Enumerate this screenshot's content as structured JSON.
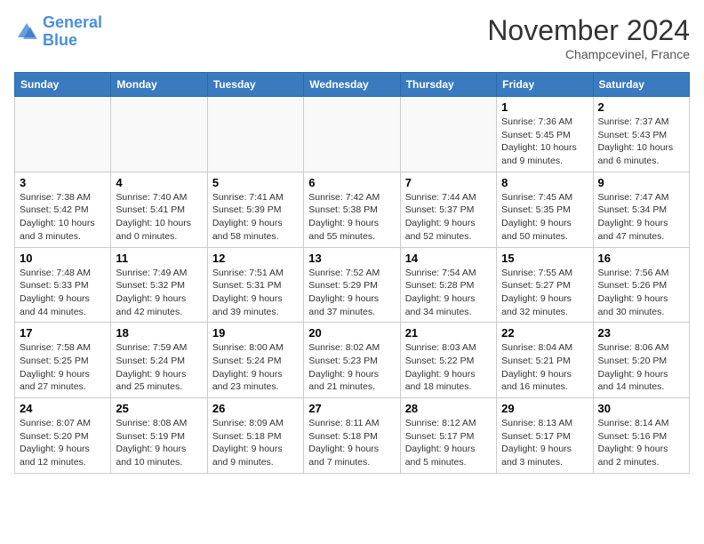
{
  "header": {
    "logo_line1": "General",
    "logo_line2": "Blue",
    "month_title": "November 2024",
    "location": "Champcevinel, France"
  },
  "weekdays": [
    "Sunday",
    "Monday",
    "Tuesday",
    "Wednesday",
    "Thursday",
    "Friday",
    "Saturday"
  ],
  "weeks": [
    [
      {
        "day": "",
        "info": ""
      },
      {
        "day": "",
        "info": ""
      },
      {
        "day": "",
        "info": ""
      },
      {
        "day": "",
        "info": ""
      },
      {
        "day": "",
        "info": ""
      },
      {
        "day": "1",
        "info": "Sunrise: 7:36 AM\nSunset: 5:45 PM\nDaylight: 10 hours and 9 minutes."
      },
      {
        "day": "2",
        "info": "Sunrise: 7:37 AM\nSunset: 5:43 PM\nDaylight: 10 hours and 6 minutes."
      }
    ],
    [
      {
        "day": "3",
        "info": "Sunrise: 7:38 AM\nSunset: 5:42 PM\nDaylight: 10 hours and 3 minutes."
      },
      {
        "day": "4",
        "info": "Sunrise: 7:40 AM\nSunset: 5:41 PM\nDaylight: 10 hours and 0 minutes."
      },
      {
        "day": "5",
        "info": "Sunrise: 7:41 AM\nSunset: 5:39 PM\nDaylight: 9 hours and 58 minutes."
      },
      {
        "day": "6",
        "info": "Sunrise: 7:42 AM\nSunset: 5:38 PM\nDaylight: 9 hours and 55 minutes."
      },
      {
        "day": "7",
        "info": "Sunrise: 7:44 AM\nSunset: 5:37 PM\nDaylight: 9 hours and 52 minutes."
      },
      {
        "day": "8",
        "info": "Sunrise: 7:45 AM\nSunset: 5:35 PM\nDaylight: 9 hours and 50 minutes."
      },
      {
        "day": "9",
        "info": "Sunrise: 7:47 AM\nSunset: 5:34 PM\nDaylight: 9 hours and 47 minutes."
      }
    ],
    [
      {
        "day": "10",
        "info": "Sunrise: 7:48 AM\nSunset: 5:33 PM\nDaylight: 9 hours and 44 minutes."
      },
      {
        "day": "11",
        "info": "Sunrise: 7:49 AM\nSunset: 5:32 PM\nDaylight: 9 hours and 42 minutes."
      },
      {
        "day": "12",
        "info": "Sunrise: 7:51 AM\nSunset: 5:31 PM\nDaylight: 9 hours and 39 minutes."
      },
      {
        "day": "13",
        "info": "Sunrise: 7:52 AM\nSunset: 5:29 PM\nDaylight: 9 hours and 37 minutes."
      },
      {
        "day": "14",
        "info": "Sunrise: 7:54 AM\nSunset: 5:28 PM\nDaylight: 9 hours and 34 minutes."
      },
      {
        "day": "15",
        "info": "Sunrise: 7:55 AM\nSunset: 5:27 PM\nDaylight: 9 hours and 32 minutes."
      },
      {
        "day": "16",
        "info": "Sunrise: 7:56 AM\nSunset: 5:26 PM\nDaylight: 9 hours and 30 minutes."
      }
    ],
    [
      {
        "day": "17",
        "info": "Sunrise: 7:58 AM\nSunset: 5:25 PM\nDaylight: 9 hours and 27 minutes."
      },
      {
        "day": "18",
        "info": "Sunrise: 7:59 AM\nSunset: 5:24 PM\nDaylight: 9 hours and 25 minutes."
      },
      {
        "day": "19",
        "info": "Sunrise: 8:00 AM\nSunset: 5:24 PM\nDaylight: 9 hours and 23 minutes."
      },
      {
        "day": "20",
        "info": "Sunrise: 8:02 AM\nSunset: 5:23 PM\nDaylight: 9 hours and 21 minutes."
      },
      {
        "day": "21",
        "info": "Sunrise: 8:03 AM\nSunset: 5:22 PM\nDaylight: 9 hours and 18 minutes."
      },
      {
        "day": "22",
        "info": "Sunrise: 8:04 AM\nSunset: 5:21 PM\nDaylight: 9 hours and 16 minutes."
      },
      {
        "day": "23",
        "info": "Sunrise: 8:06 AM\nSunset: 5:20 PM\nDaylight: 9 hours and 14 minutes."
      }
    ],
    [
      {
        "day": "24",
        "info": "Sunrise: 8:07 AM\nSunset: 5:20 PM\nDaylight: 9 hours and 12 minutes."
      },
      {
        "day": "25",
        "info": "Sunrise: 8:08 AM\nSunset: 5:19 PM\nDaylight: 9 hours and 10 minutes."
      },
      {
        "day": "26",
        "info": "Sunrise: 8:09 AM\nSunset: 5:18 PM\nDaylight: 9 hours and 9 minutes."
      },
      {
        "day": "27",
        "info": "Sunrise: 8:11 AM\nSunset: 5:18 PM\nDaylight: 9 hours and 7 minutes."
      },
      {
        "day": "28",
        "info": "Sunrise: 8:12 AM\nSunset: 5:17 PM\nDaylight: 9 hours and 5 minutes."
      },
      {
        "day": "29",
        "info": "Sunrise: 8:13 AM\nSunset: 5:17 PM\nDaylight: 9 hours and 3 minutes."
      },
      {
        "day": "30",
        "info": "Sunrise: 8:14 AM\nSunset: 5:16 PM\nDaylight: 9 hours and 2 minutes."
      }
    ]
  ]
}
